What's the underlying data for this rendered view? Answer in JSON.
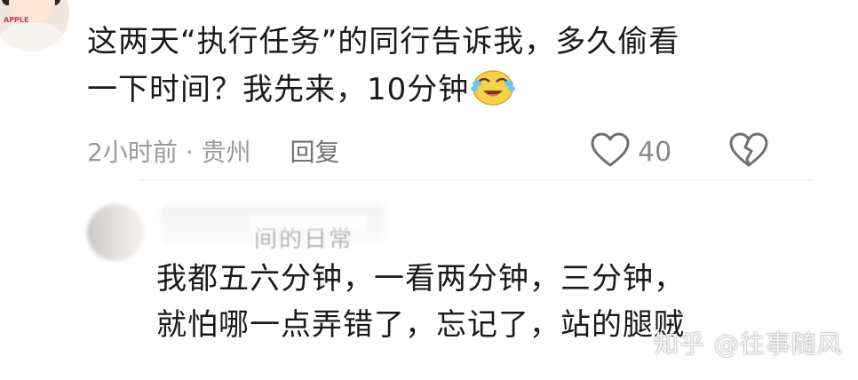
{
  "comment": {
    "text_line1": "这两天“执行任务”的同行告诉我，多久偷看",
    "text_line2": "一下时间？我先来，10分钟",
    "emoji": "laughing-crying-emoji",
    "time_location": "2小时前 · 贵州",
    "reply_label": "回复",
    "like_count": "40"
  },
  "reply": {
    "author_partial": "间的日常",
    "text_line1": "我都五六分钟，一看两分钟，三分钟，",
    "text_line2": "就怕哪一点弄错了，忘记了，站的腿贼"
  },
  "watermark": "知乎 @往事随风",
  "colors": {
    "text": "#1a1a1a",
    "meta": "#9a9a9a",
    "icon": "#6f6f6f"
  }
}
